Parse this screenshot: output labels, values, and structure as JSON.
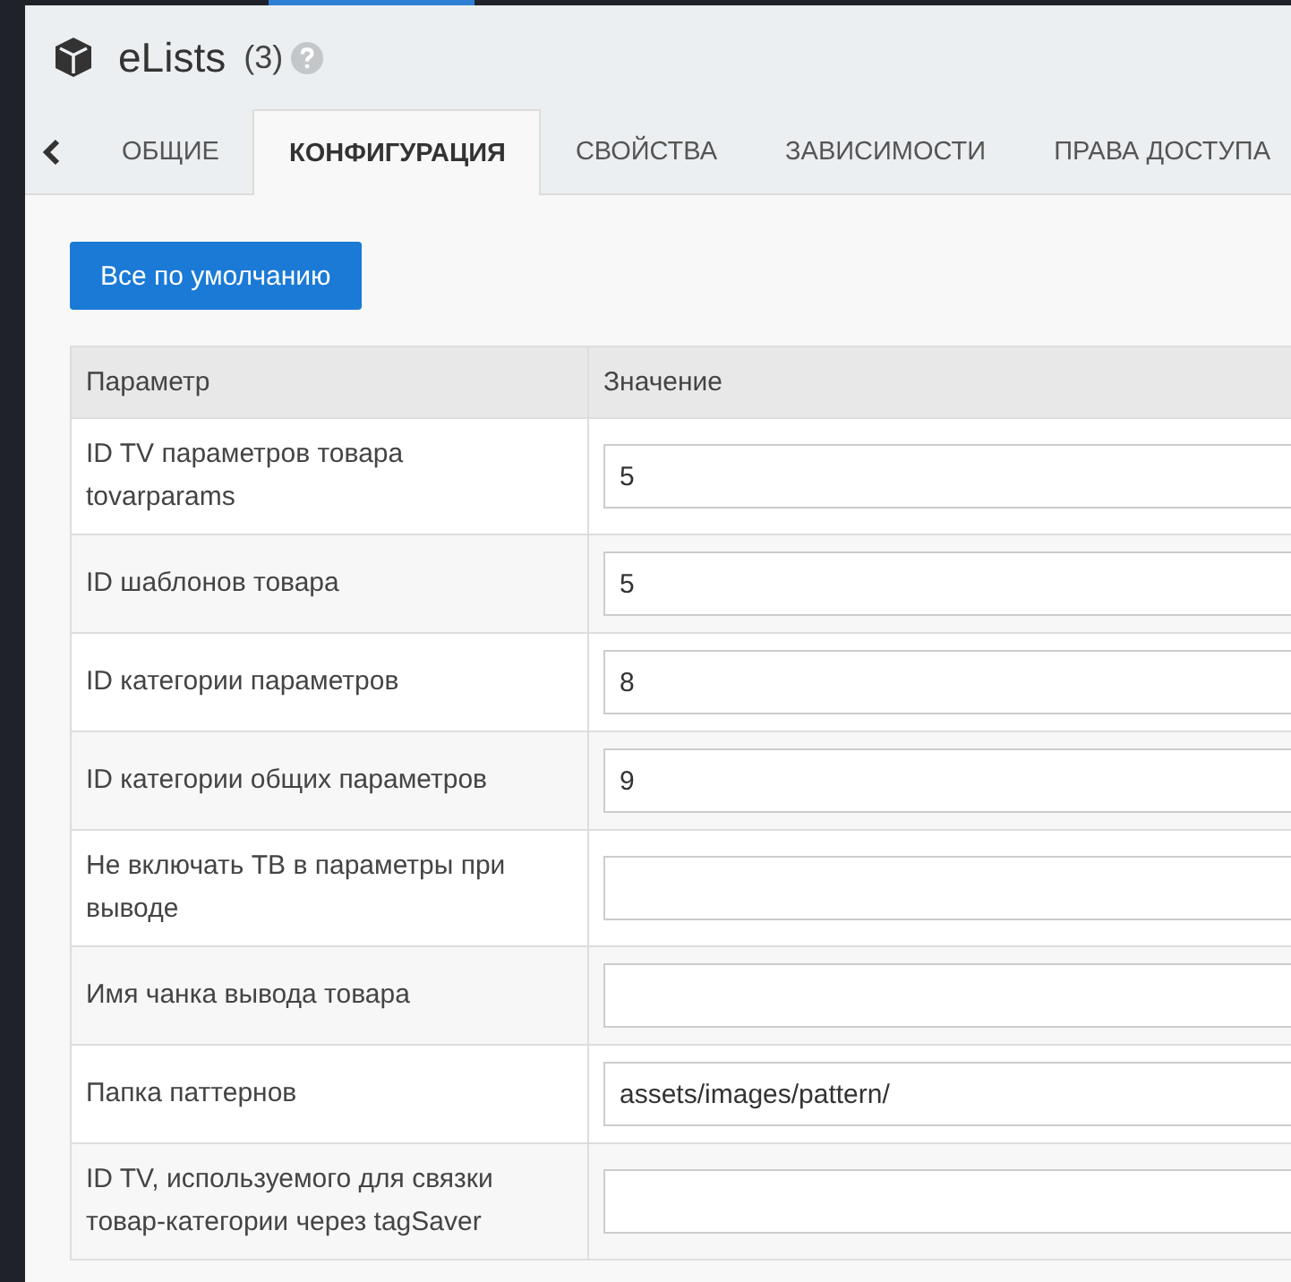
{
  "header": {
    "title": "eLists",
    "count": "(3)"
  },
  "tabs": [
    {
      "label": "ОБЩИЕ",
      "selected": false
    },
    {
      "label": "КОНФИГУРАЦИЯ",
      "selected": true
    },
    {
      "label": "СВОЙСТВА",
      "selected": false
    },
    {
      "label": "ЗАВИСИМОСТИ",
      "selected": false
    },
    {
      "label": "ПРАВА ДОСТУПА",
      "selected": false
    }
  ],
  "defaults_button": "Все по умолчанию",
  "table": {
    "columns": [
      "Параметр",
      "Значение"
    ],
    "rows": [
      {
        "param": "ID TV параметров товара tovarparams",
        "value": "5"
      },
      {
        "param": "ID шаблонов товара",
        "value": "5"
      },
      {
        "param": "ID категории параметров",
        "value": "8"
      },
      {
        "param": "ID категории общих параметров",
        "value": "9"
      },
      {
        "param": "Не включать ТВ в параметры при выводе",
        "value": ""
      },
      {
        "param": "Имя чанка вывода товара",
        "value": ""
      },
      {
        "param": "Папка паттернов",
        "value": "assets/images/pattern/"
      },
      {
        "param": "ID TV, используемого для связки товар-категории через tagSaver",
        "value": ""
      }
    ]
  }
}
